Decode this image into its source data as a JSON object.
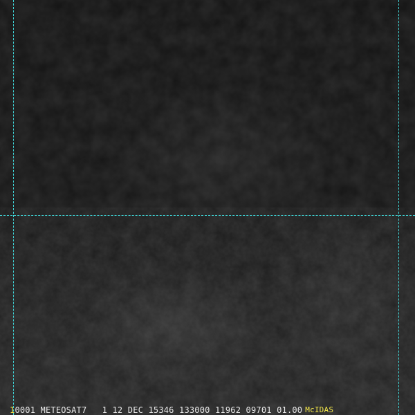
{
  "status_bar": {
    "frame_number": "1",
    "image_info": "0001 METEOSAT7   1 12 DEC 15346 133000 11962 09701 01.00",
    "brand": "McIDAS"
  },
  "colors": {
    "grid_line": "#3fd4d6",
    "frame_number": "#f2e64a",
    "brand": "#f2e64a",
    "status_text": "#ececec",
    "background": "#141414"
  }
}
